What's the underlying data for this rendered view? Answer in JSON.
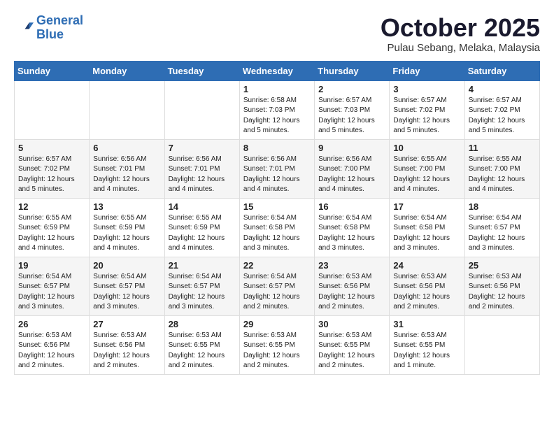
{
  "header": {
    "logo": {
      "line1": "General",
      "line2": "Blue"
    },
    "title": "October 2025",
    "subtitle": "Pulau Sebang, Melaka, Malaysia"
  },
  "weekdays": [
    "Sunday",
    "Monday",
    "Tuesday",
    "Wednesday",
    "Thursday",
    "Friday",
    "Saturday"
  ],
  "weeks": [
    [
      {
        "day": "",
        "info": ""
      },
      {
        "day": "",
        "info": ""
      },
      {
        "day": "",
        "info": ""
      },
      {
        "day": "1",
        "info": "Sunrise: 6:58 AM\nSunset: 7:03 PM\nDaylight: 12 hours\nand 5 minutes."
      },
      {
        "day": "2",
        "info": "Sunrise: 6:57 AM\nSunset: 7:03 PM\nDaylight: 12 hours\nand 5 minutes."
      },
      {
        "day": "3",
        "info": "Sunrise: 6:57 AM\nSunset: 7:02 PM\nDaylight: 12 hours\nand 5 minutes."
      },
      {
        "day": "4",
        "info": "Sunrise: 6:57 AM\nSunset: 7:02 PM\nDaylight: 12 hours\nand 5 minutes."
      }
    ],
    [
      {
        "day": "5",
        "info": "Sunrise: 6:57 AM\nSunset: 7:02 PM\nDaylight: 12 hours\nand 5 minutes."
      },
      {
        "day": "6",
        "info": "Sunrise: 6:56 AM\nSunset: 7:01 PM\nDaylight: 12 hours\nand 4 minutes."
      },
      {
        "day": "7",
        "info": "Sunrise: 6:56 AM\nSunset: 7:01 PM\nDaylight: 12 hours\nand 4 minutes."
      },
      {
        "day": "8",
        "info": "Sunrise: 6:56 AM\nSunset: 7:01 PM\nDaylight: 12 hours\nand 4 minutes."
      },
      {
        "day": "9",
        "info": "Sunrise: 6:56 AM\nSunset: 7:00 PM\nDaylight: 12 hours\nand 4 minutes."
      },
      {
        "day": "10",
        "info": "Sunrise: 6:55 AM\nSunset: 7:00 PM\nDaylight: 12 hours\nand 4 minutes."
      },
      {
        "day": "11",
        "info": "Sunrise: 6:55 AM\nSunset: 7:00 PM\nDaylight: 12 hours\nand 4 minutes."
      }
    ],
    [
      {
        "day": "12",
        "info": "Sunrise: 6:55 AM\nSunset: 6:59 PM\nDaylight: 12 hours\nand 4 minutes."
      },
      {
        "day": "13",
        "info": "Sunrise: 6:55 AM\nSunset: 6:59 PM\nDaylight: 12 hours\nand 4 minutes."
      },
      {
        "day": "14",
        "info": "Sunrise: 6:55 AM\nSunset: 6:59 PM\nDaylight: 12 hours\nand 4 minutes."
      },
      {
        "day": "15",
        "info": "Sunrise: 6:54 AM\nSunset: 6:58 PM\nDaylight: 12 hours\nand 3 minutes."
      },
      {
        "day": "16",
        "info": "Sunrise: 6:54 AM\nSunset: 6:58 PM\nDaylight: 12 hours\nand 3 minutes."
      },
      {
        "day": "17",
        "info": "Sunrise: 6:54 AM\nSunset: 6:58 PM\nDaylight: 12 hours\nand 3 minutes."
      },
      {
        "day": "18",
        "info": "Sunrise: 6:54 AM\nSunset: 6:57 PM\nDaylight: 12 hours\nand 3 minutes."
      }
    ],
    [
      {
        "day": "19",
        "info": "Sunrise: 6:54 AM\nSunset: 6:57 PM\nDaylight: 12 hours\nand 3 minutes."
      },
      {
        "day": "20",
        "info": "Sunrise: 6:54 AM\nSunset: 6:57 PM\nDaylight: 12 hours\nand 3 minutes."
      },
      {
        "day": "21",
        "info": "Sunrise: 6:54 AM\nSunset: 6:57 PM\nDaylight: 12 hours\nand 3 minutes."
      },
      {
        "day": "22",
        "info": "Sunrise: 6:54 AM\nSunset: 6:57 PM\nDaylight: 12 hours\nand 2 minutes."
      },
      {
        "day": "23",
        "info": "Sunrise: 6:53 AM\nSunset: 6:56 PM\nDaylight: 12 hours\nand 2 minutes."
      },
      {
        "day": "24",
        "info": "Sunrise: 6:53 AM\nSunset: 6:56 PM\nDaylight: 12 hours\nand 2 minutes."
      },
      {
        "day": "25",
        "info": "Sunrise: 6:53 AM\nSunset: 6:56 PM\nDaylight: 12 hours\nand 2 minutes."
      }
    ],
    [
      {
        "day": "26",
        "info": "Sunrise: 6:53 AM\nSunset: 6:56 PM\nDaylight: 12 hours\nand 2 minutes."
      },
      {
        "day": "27",
        "info": "Sunrise: 6:53 AM\nSunset: 6:56 PM\nDaylight: 12 hours\nand 2 minutes."
      },
      {
        "day": "28",
        "info": "Sunrise: 6:53 AM\nSunset: 6:55 PM\nDaylight: 12 hours\nand 2 minutes."
      },
      {
        "day": "29",
        "info": "Sunrise: 6:53 AM\nSunset: 6:55 PM\nDaylight: 12 hours\nand 2 minutes."
      },
      {
        "day": "30",
        "info": "Sunrise: 6:53 AM\nSunset: 6:55 PM\nDaylight: 12 hours\nand 2 minutes."
      },
      {
        "day": "31",
        "info": "Sunrise: 6:53 AM\nSunset: 6:55 PM\nDaylight: 12 hours\nand 1 minute."
      },
      {
        "day": "",
        "info": ""
      }
    ]
  ]
}
